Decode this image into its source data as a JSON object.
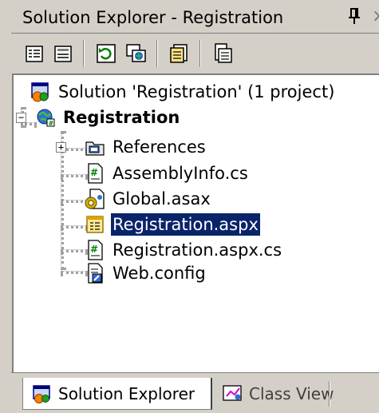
{
  "window": {
    "title": "Solution Explorer - Registration"
  },
  "toolbar": {
    "buttons": [
      {
        "name": "properties-icon"
      },
      {
        "name": "show-all-files-icon"
      },
      {
        "name": "refresh-icon"
      },
      {
        "name": "copy-project-icon"
      },
      {
        "name": "view-code-icon"
      },
      {
        "name": "view-designer-icon"
      }
    ]
  },
  "tree": {
    "solution": "Solution 'Registration' (1 project)",
    "project": "Registration",
    "items": [
      {
        "label": "References",
        "icon": "references-icon",
        "expandable": true
      },
      {
        "label": "AssemblyInfo.cs",
        "icon": "csharp-file-icon"
      },
      {
        "label": "Global.asax",
        "icon": "global-asax-icon"
      },
      {
        "label": "Registration.aspx",
        "icon": "aspx-file-icon",
        "selected": true
      },
      {
        "label": "Registration.aspx.cs",
        "icon": "csharp-file-icon"
      },
      {
        "label": "Web.config",
        "icon": "config-file-icon"
      }
    ]
  },
  "tabs": {
    "solution_explorer": "Solution Explorer",
    "class_view": "Class View"
  },
  "colors": {
    "chrome": "#d4d0c8",
    "selection": "#0a246a"
  }
}
